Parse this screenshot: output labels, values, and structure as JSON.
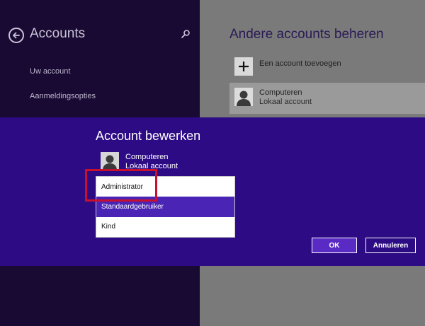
{
  "left": {
    "title": "Accounts",
    "nav": [
      {
        "label": "Uw account"
      },
      {
        "label": "Aanmeldingsopties"
      }
    ]
  },
  "right": {
    "title": "Andere accounts beheren",
    "add_label": "Een account toevoegen",
    "account": {
      "name": "Computeren",
      "type": "Lokaal account"
    }
  },
  "dialog": {
    "title": "Account bewerken",
    "account": {
      "name": "Computeren",
      "type": "Lokaal account"
    },
    "options": [
      "Administrator",
      "Standaardgebruiker",
      "Kind"
    ],
    "ok_label": "OK",
    "cancel_label": "Annuleren"
  },
  "icons": {
    "back": "back-arrow-icon",
    "search": "search-icon",
    "add": "plus-icon",
    "avatar": "user-avatar-icon"
  },
  "colors": {
    "dialog_bg": "#2d0b84",
    "selected_option": "#4a25b5",
    "highlight": "#c8102e"
  }
}
